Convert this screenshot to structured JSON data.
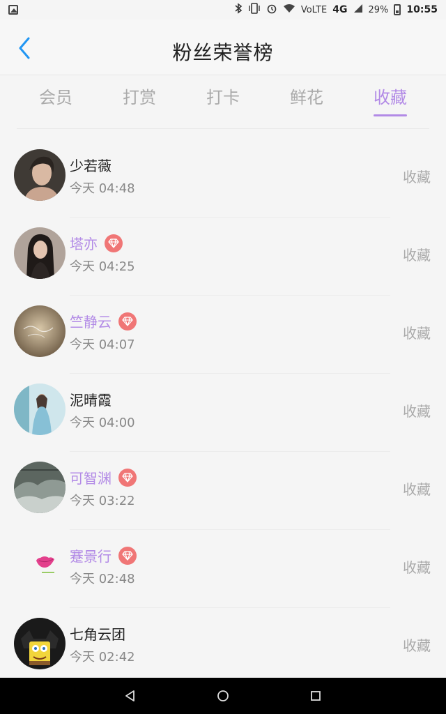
{
  "status_bar": {
    "network": "VoLTE",
    "network_type": "4G",
    "battery": "29%",
    "time": "10:55"
  },
  "header": {
    "title": "粉丝荣誉榜"
  },
  "tabs": [
    {
      "label": "会员",
      "active": false
    },
    {
      "label": "打赏",
      "active": false
    },
    {
      "label": "打卡",
      "active": false
    },
    {
      "label": "鲜花",
      "active": false
    },
    {
      "label": "收藏",
      "active": true
    }
  ],
  "list": {
    "items": [
      {
        "name": "少若薇",
        "time": "今天 04:48",
        "vip": false,
        "action": "收藏",
        "avatar_icon": "portrait-avatar"
      },
      {
        "name": "塔亦",
        "time": "今天 04:25",
        "vip": true,
        "action": "收藏",
        "avatar_icon": "portrait-avatar"
      },
      {
        "name": "竺静云",
        "time": "今天 04:07",
        "vip": true,
        "action": "收藏",
        "avatar_icon": "landscape-avatar"
      },
      {
        "name": "泥晴霞",
        "time": "今天 04:00",
        "vip": false,
        "action": "收藏",
        "avatar_icon": "landscape-avatar"
      },
      {
        "name": "可智渊",
        "time": "今天 03:22",
        "vip": true,
        "action": "收藏",
        "avatar_icon": "landscape-avatar"
      },
      {
        "name": "蹇景行",
        "time": "今天 02:48",
        "vip": true,
        "action": "收藏",
        "avatar_icon": "lips-avatar"
      },
      {
        "name": "七角云团",
        "time": "今天 02:42",
        "vip": false,
        "action": "收藏",
        "avatar_icon": "cartoon-avatar"
      }
    ]
  },
  "colors": {
    "accent": "#b28ae6",
    "vip_badge": "#f07676",
    "nav_bar": "#000000"
  }
}
